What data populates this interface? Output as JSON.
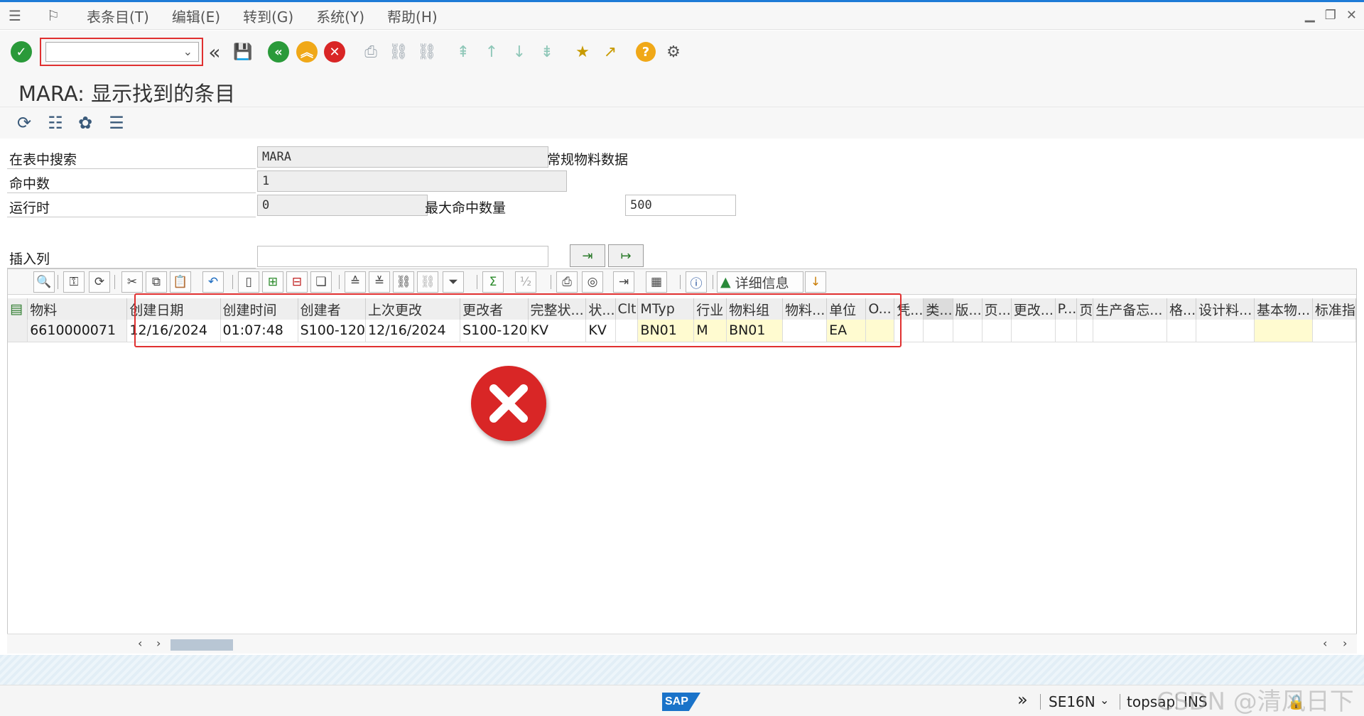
{
  "menu": {
    "items": [
      "表条目(T)",
      "编辑(E)",
      "转到(G)",
      "系统(Y)",
      "帮助(H)"
    ]
  },
  "page": {
    "title": "MARA: 显示找到的条目"
  },
  "form": {
    "search_table_label": "在表中搜索",
    "search_table_value": "MARA",
    "search_table_desc": "常规物料数据",
    "hits_label": "命中数",
    "hits_value": "1",
    "runtime_label": "运行时",
    "runtime_value": "0",
    "max_hits_label": "最大命中数量",
    "max_hits_value": "500",
    "insert_col_label": "插入列",
    "insert_col_value": ""
  },
  "alv_toolbar": {
    "detail_label": "详细信息"
  },
  "grid": {
    "columns": [
      "物料",
      "创建日期",
      "创建时间",
      "创建者",
      "上次更改",
      "更改者",
      "完整状...",
      "状...",
      "Clt",
      "MTyp",
      "行业",
      "物料组",
      "物料...",
      "单位",
      "O...",
      "凭...",
      "类...",
      "版...",
      "页...",
      "更改...",
      "P...",
      "页",
      "生产备忘...",
      "格...",
      "设计料...",
      "基本物...",
      "标准指"
    ],
    "rows": [
      [
        "6610000071",
        "12/16/2024",
        "01:07:48",
        "S100-120",
        "12/16/2024",
        "S100-120",
        "KV",
        "KV",
        "",
        "BN01",
        "M",
        "BN01",
        "",
        "EA",
        "",
        "",
        "",
        "",
        "",
        "",
        "",
        "",
        "",
        "",
        "",
        "",
        ""
      ]
    ]
  },
  "status": {
    "logo_text": "SAP",
    "transaction": "SE16N",
    "system": "topsap",
    "mode": "INS"
  },
  "watermark": "CSDN @清风日下"
}
